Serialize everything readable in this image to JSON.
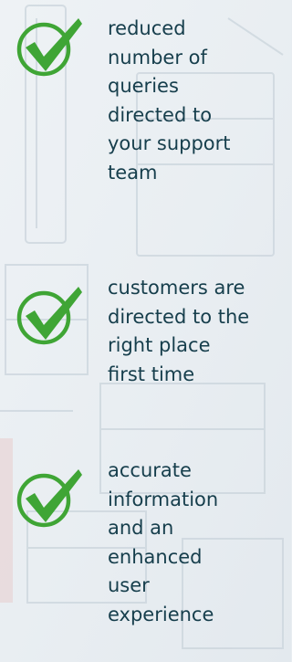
{
  "benefits": [
    {
      "icon": "checkmark-icon",
      "text": "reduced\nnumber of\nqueries\ndirected to\nyour support\nteam"
    },
    {
      "icon": "checkmark-icon",
      "text": "customers are\ndirected to the\nright place\nfirst time"
    },
    {
      "icon": "checkmark-icon",
      "text": "accurate\ninformation\nand an\nenhanced\nuser\nexperience"
    }
  ],
  "colors": {
    "check_green": "#3fa535",
    "text": "#163e4c",
    "background": "#e8edf1"
  }
}
